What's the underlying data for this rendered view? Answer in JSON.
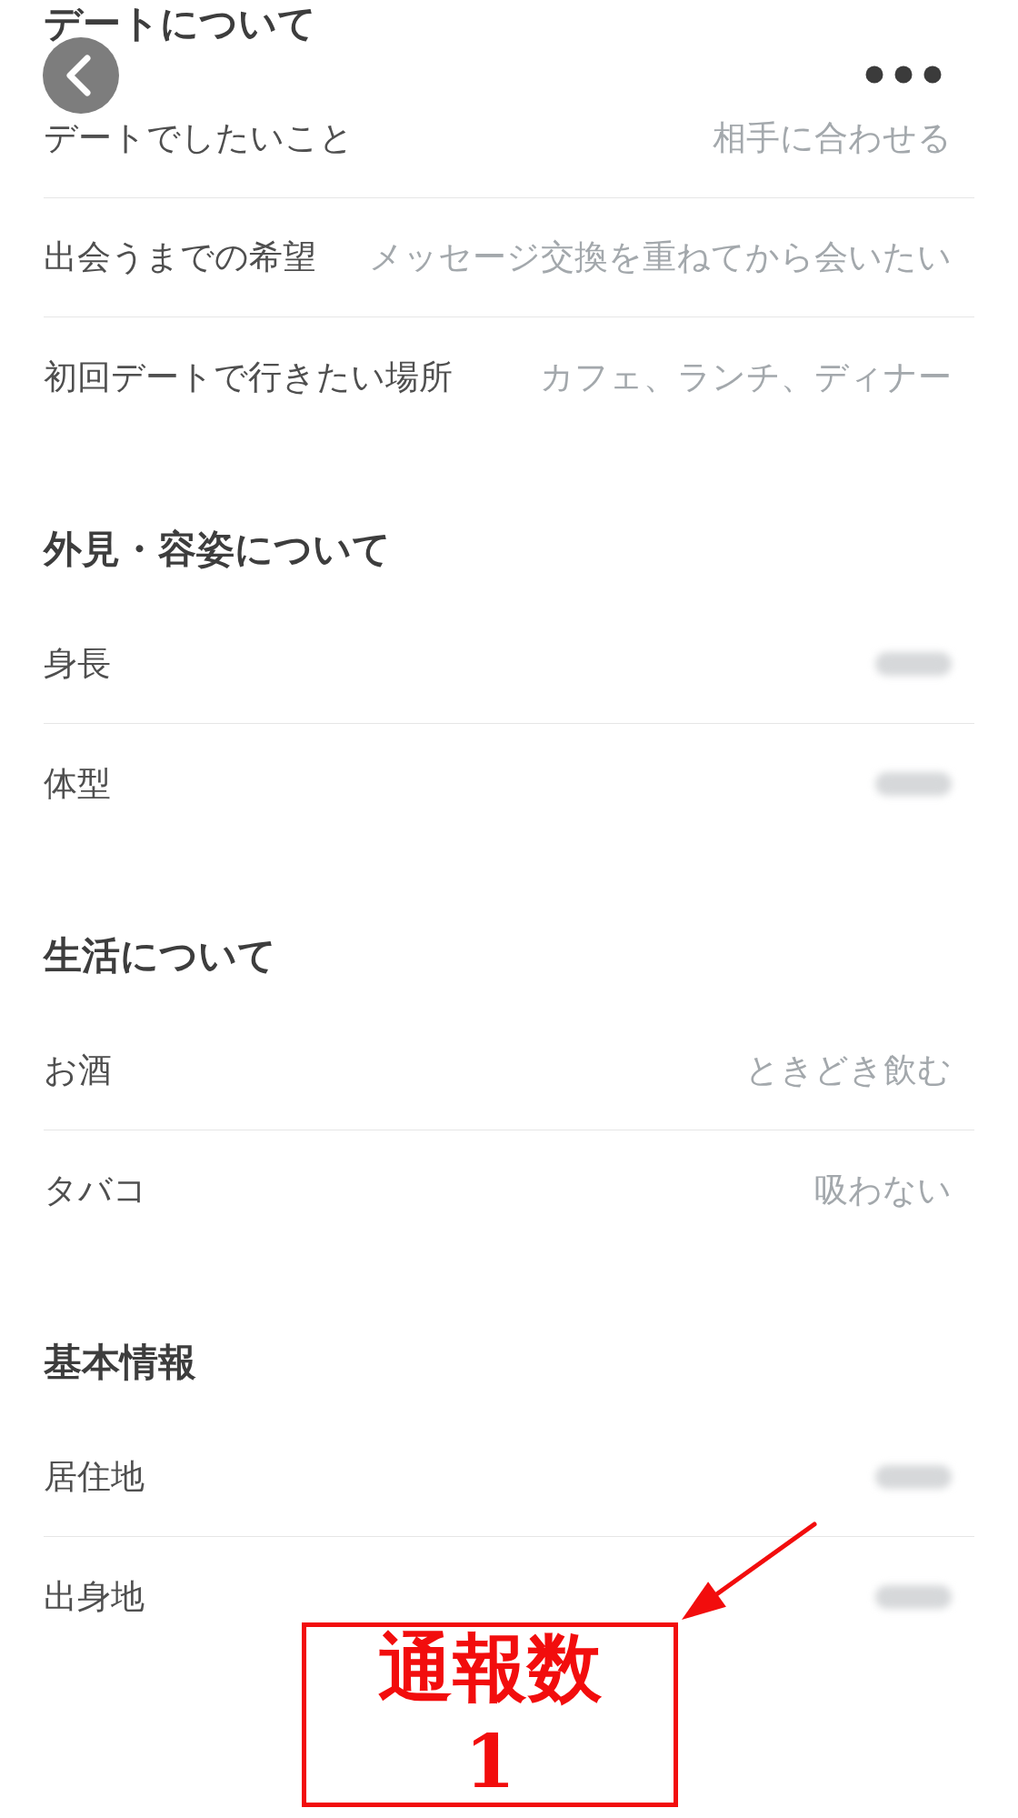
{
  "sections": [
    {
      "title": "デートについて",
      "rows": [
        {
          "label": "デートでしたいこと",
          "kind": "text",
          "value": "相手に合わせる"
        },
        {
          "label": "出会うまでの希望",
          "kind": "text",
          "value": "メッセージ交換を重ねてから会いたい"
        },
        {
          "label": "初回デートで行きたい場所",
          "kind": "text",
          "value": "カフェ、ランチ、ディナー"
        }
      ]
    },
    {
      "title": "外見・容姿について",
      "rows": [
        {
          "label": "身長",
          "kind": "blurred"
        },
        {
          "label": "体型",
          "kind": "blurred"
        }
      ]
    },
    {
      "title": "生活について",
      "rows": [
        {
          "label": "お酒",
          "kind": "text",
          "value": "ときどき飲む"
        },
        {
          "label": "タバコ",
          "kind": "text",
          "value": "吸わない"
        }
      ]
    },
    {
      "title": "基本情報",
      "rows": [
        {
          "label": "居住地",
          "kind": "blurred"
        },
        {
          "label": "出身地",
          "kind": "blurred"
        }
      ]
    }
  ],
  "annotation": {
    "title": "通報数",
    "count": "1"
  }
}
